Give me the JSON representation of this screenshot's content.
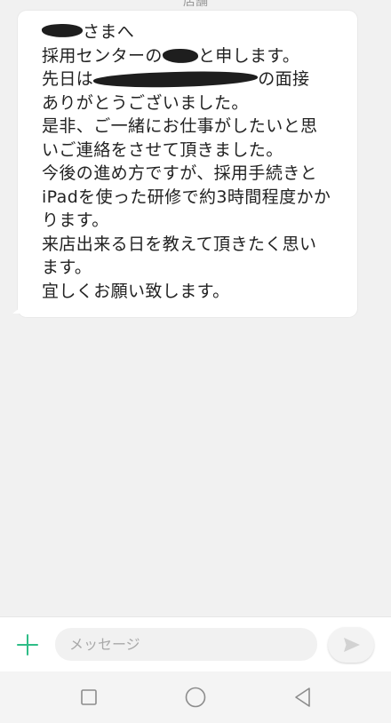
{
  "header": {
    "partial_title": "店舗"
  },
  "message": {
    "lines": [
      {
        "pre": "",
        "redact": "a",
        "post": "さまへ"
      },
      {
        "pre": "採用センターの",
        "redact": "b",
        "post": "と申します。"
      },
      {
        "pre": "先日は",
        "redact": "c",
        "post": "の面接"
      },
      {
        "pre": "ありがとうございました。",
        "redact": "",
        "post": ""
      },
      {
        "pre": "是非、ご一緒にお仕事がしたいと思",
        "redact": "",
        "post": ""
      },
      {
        "pre": "いご連絡をさせて頂きました。",
        "redact": "",
        "post": ""
      },
      {
        "pre": "今後の進め方ですが、採用手続きと",
        "redact": "",
        "post": ""
      },
      {
        "pre": "iPadを使った研修で約3時間程度かか",
        "redact": "",
        "post": ""
      },
      {
        "pre": "ります。",
        "redact": "",
        "post": ""
      },
      {
        "pre": "来店出来る日を教えて頂きたく思い",
        "redact": "",
        "post": ""
      },
      {
        "pre": "ます。",
        "redact": "",
        "post": ""
      },
      {
        "pre": "宜しくお願い致します。",
        "redact": "",
        "post": ""
      }
    ]
  },
  "composer": {
    "placeholder": "メッセージ",
    "add_icon": "plus-icon",
    "send_icon": "send-icon",
    "accent_color": "#2ebd87"
  },
  "navbar": {
    "icons": [
      "recent-apps-icon",
      "home-icon",
      "back-icon"
    ]
  }
}
